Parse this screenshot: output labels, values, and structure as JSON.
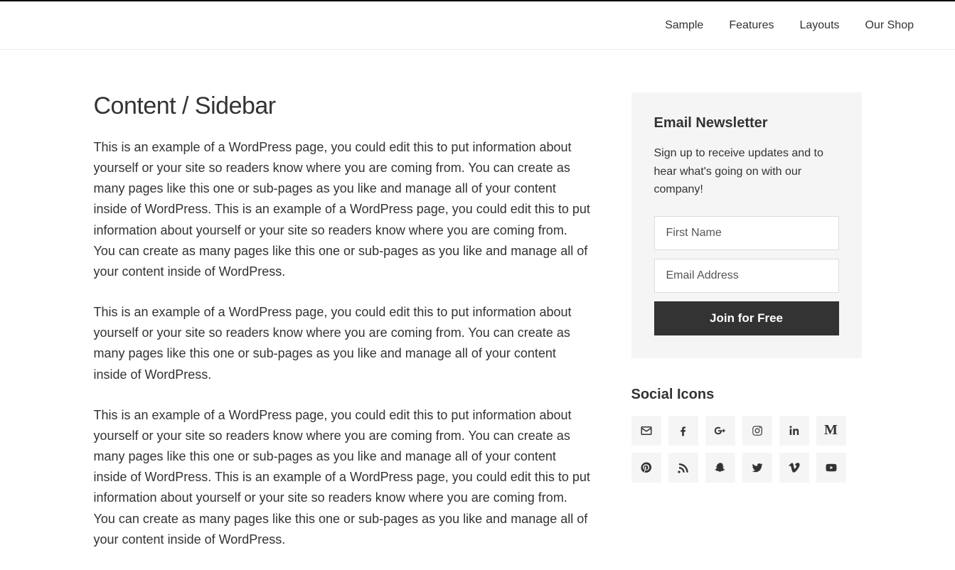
{
  "nav": {
    "items": [
      "Sample",
      "Features",
      "Layouts",
      "Our Shop"
    ]
  },
  "article": {
    "title": "Content / Sidebar",
    "paragraphs": [
      "This is an example of a WordPress page, you could edit this to put information about yourself or your site so readers know where you are coming from. You can create as many pages like this one or sub-pages as you like and manage all of your content inside of WordPress. This is an example of a WordPress page, you could edit this to put information about yourself or your site so readers know where you are coming from. You can create as many pages like this one or sub-pages as you like and manage all of your content inside of WordPress.",
      "This is an example of a WordPress page, you could edit this to put information about yourself or your site so readers know where you are coming from. You can create as many pages like this one or sub-pages as you like and manage all of your content inside of WordPress.",
      "This is an example of a WordPress page, you could edit this to put information about yourself or your site so readers know where you are coming from. You can create as many pages like this one or sub-pages as you like and manage all of your content inside of WordPress. This is an example of a WordPress page, you could edit this to put information about yourself or your site so readers know where you are coming from. You can create as many pages like this one or sub-pages as you like and manage all of your content inside of WordPress."
    ]
  },
  "newsletter": {
    "heading": "Email Newsletter",
    "description": "Sign up to receive updates and to hear what's going on with our company!",
    "first_name_placeholder": "First Name",
    "email_placeholder": "Email Address",
    "button_label": "Join for Free"
  },
  "social": {
    "heading": "Social Icons",
    "icons": [
      "email-icon",
      "facebook-icon",
      "google-plus-icon",
      "instagram-icon",
      "linkedin-icon",
      "medium-icon",
      "pinterest-icon",
      "rss-icon",
      "snapchat-icon",
      "twitter-icon",
      "vimeo-icon",
      "youtube-icon"
    ]
  }
}
